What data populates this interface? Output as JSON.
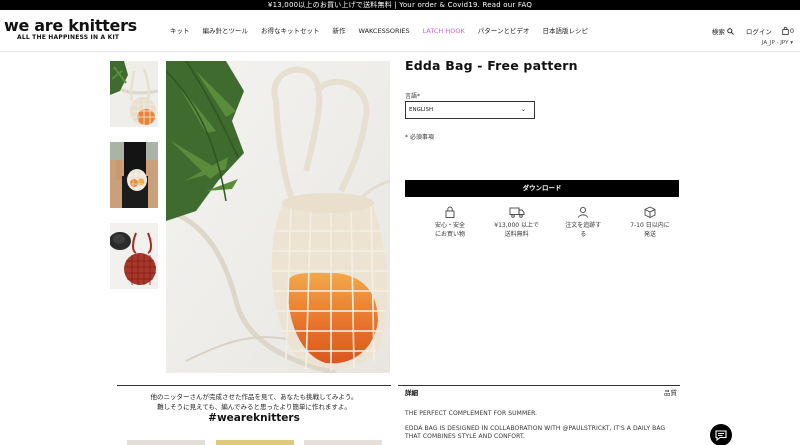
{
  "announcement": "¥13,000以上のお買い上げで送料無料 | Your order & Covid19. Read our FAQ",
  "logo": {
    "name": "we are knitters",
    "tagline": "ALL THE HAPPINESS IN A KIT"
  },
  "nav": [
    {
      "label": "キット"
    },
    {
      "label": "編み針とツール"
    },
    {
      "label": "お得なキットセット"
    },
    {
      "label": "新作"
    },
    {
      "label": "WAKCESSORIES"
    },
    {
      "label": "LATCH HOOK"
    },
    {
      "label": "パターンとビデオ"
    },
    {
      "label": "日本語版レシピ"
    }
  ],
  "header_right": {
    "search": "検索",
    "login": "ログイン",
    "cart_count": "0",
    "locale": "JA_JP - JPY ▾"
  },
  "product": {
    "title": "Edda Bag - Free pattern",
    "language_label": "言語*",
    "language_value": "ENGLISH",
    "required_note": "* 必須事項",
    "download_label": "ダウンロード"
  },
  "features": [
    {
      "icon": "lock-icon",
      "lines": [
        "安心・安全",
        "にお買い物"
      ]
    },
    {
      "icon": "truck-icon",
      "lines": [
        "¥13,000 以上で",
        "送料無料"
      ]
    },
    {
      "icon": "user-icon",
      "lines": [
        "注文を追跡す",
        "る"
      ]
    },
    {
      "icon": "box-icon",
      "lines": [
        "7-10 日以内に",
        "発送"
      ]
    }
  ],
  "promo": {
    "line1": "他のニッターさんが完成させた作品を見て、あなたも挑戦してみよう。",
    "line2": "難しそうに見えても、編んでみると思ったより簡単に作れますよ。",
    "hashtag": "#weareknitters"
  },
  "details": {
    "tab": "詳細",
    "quality_tab": "品質",
    "p1": "THE PERFECT COMPLEMENT FOR SUMMER.",
    "p2_line1": "EDDA BAG IS DESIGNED IN COLLABORATION WITH @PAULSTRICKT, IT'S A DAILY BAG",
    "p2_line2": "THAT COMBINES STYLE AND CONFORT."
  },
  "colors": {
    "accent_nav": "#c86ac9",
    "button": "#000000",
    "bag": "#ece3d3",
    "orange": "#e9843a"
  }
}
